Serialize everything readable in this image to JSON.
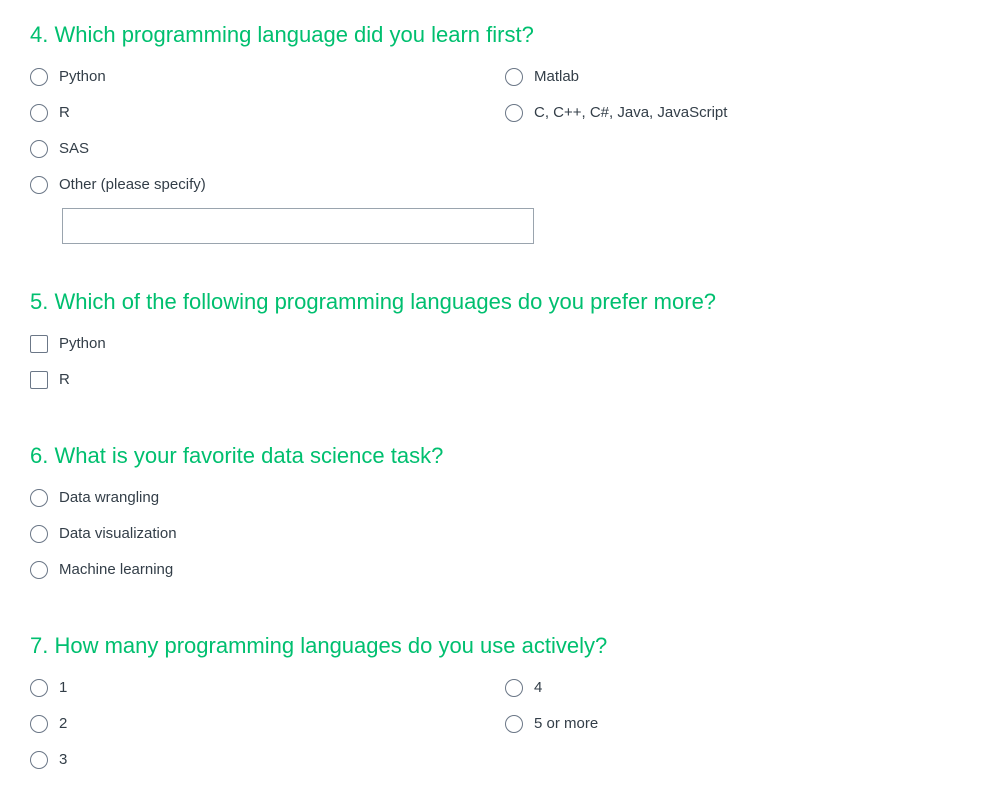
{
  "questions": [
    {
      "title": "4. Which programming language did you learn first?",
      "type": "radio",
      "options": [
        {
          "label": "Python",
          "selected": false
        },
        {
          "label": "R",
          "selected": false
        },
        {
          "label": "SAS",
          "selected": false
        },
        {
          "label": "Other (please specify)",
          "selected": false
        },
        {
          "label": "Matlab",
          "selected": false
        },
        {
          "label": "C, C++, C#, Java, JavaScript",
          "selected": false
        }
      ],
      "other_input": {
        "value": "",
        "placeholder": ""
      }
    },
    {
      "title": "5. Which of the following programming languages do you prefer more?",
      "type": "checkbox",
      "options": [
        {
          "label": "Python",
          "checked": false
        },
        {
          "label": "R",
          "checked": false
        }
      ]
    },
    {
      "title": "6. What is your favorite data science task?",
      "type": "radio",
      "options": [
        {
          "label": "Data wrangling",
          "selected": false
        },
        {
          "label": "Data visualization",
          "selected": false
        },
        {
          "label": "Machine learning",
          "selected": false
        }
      ]
    },
    {
      "title": "7. How many programming languages do you use actively?",
      "type": "radio",
      "options": [
        {
          "label": "1",
          "selected": false
        },
        {
          "label": "2",
          "selected": false
        },
        {
          "label": "3",
          "selected": false
        },
        {
          "label": "4",
          "selected": false
        },
        {
          "label": "5 or more",
          "selected": false
        }
      ]
    }
  ],
  "colors": {
    "accent": "#00bf6f",
    "text": "#333e48",
    "control_border": "#6b7787",
    "input_border": "#9aa4ae"
  }
}
